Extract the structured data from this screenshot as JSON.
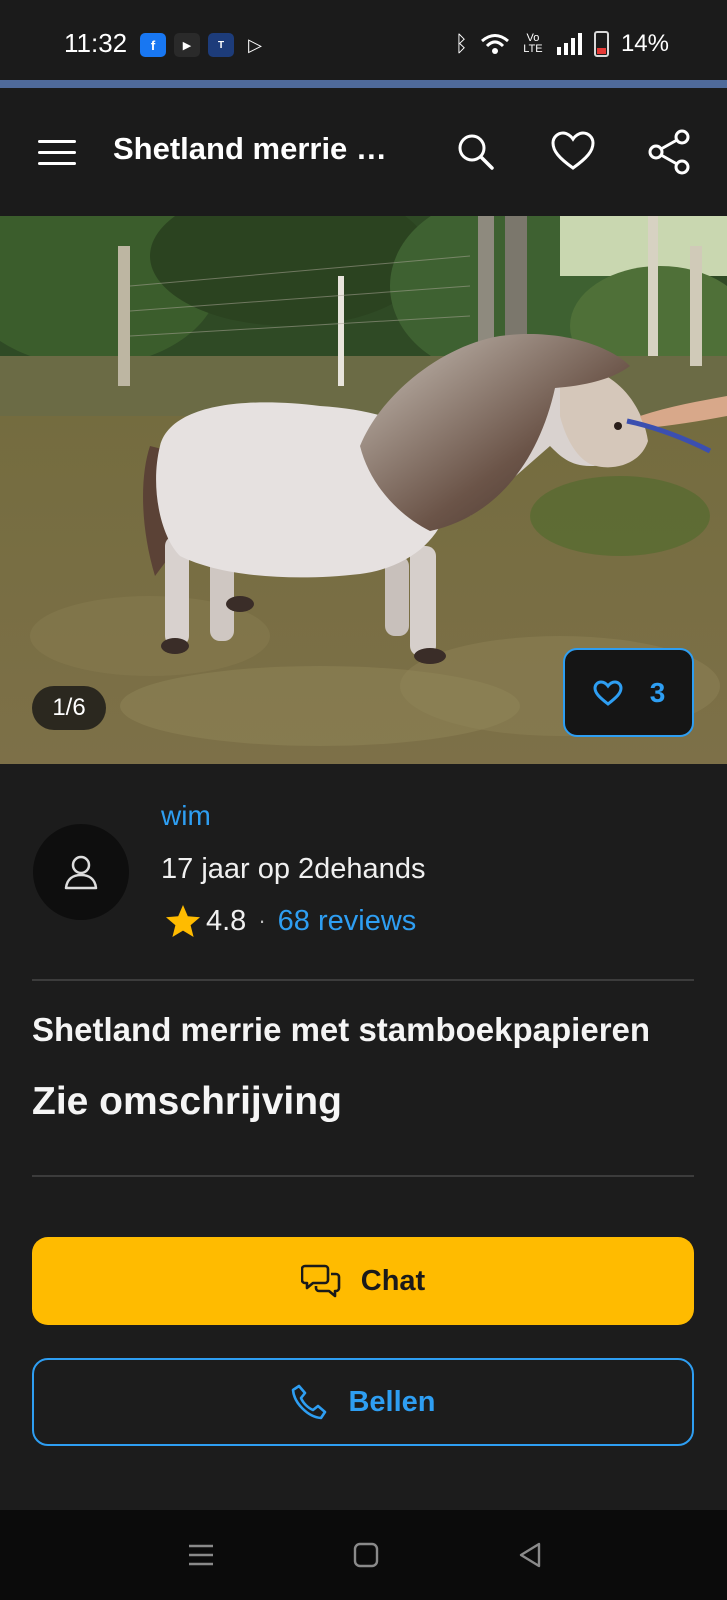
{
  "status_bar": {
    "time": "11:32",
    "app_icons": [
      {
        "name": "facebook-icon",
        "glyph": "f",
        "bg": "#1877f2",
        "fg": "#ffffff"
      },
      {
        "name": "youtube-icon",
        "glyph": "▶",
        "bg": "#2a2a2a",
        "fg": "#ffffff"
      },
      {
        "name": "de-tijd-icon",
        "glyph": "T",
        "bg": "#1d3c7a",
        "fg": "#ffffff"
      },
      {
        "name": "play-store-icon",
        "glyph": "▷",
        "bg": "transparent",
        "fg": "#ffffff"
      }
    ],
    "network": "Vo LTE",
    "battery": "14%"
  },
  "app_bar": {
    "title": "Shetland merrie met stamboekpapieren",
    "icons": [
      "menu-icon",
      "search-icon",
      "heart-icon",
      "share-icon"
    ]
  },
  "gallery": {
    "counter": "1/6",
    "favorites_count": "3"
  },
  "seller": {
    "name": "wim",
    "member_since": "17 jaar op 2dehands",
    "rating": "4.8",
    "separator": "·",
    "reviews": "68 reviews"
  },
  "listing": {
    "title": "Shetland merrie met stamboekpapieren",
    "price": "Zie omschrijving"
  },
  "actions": {
    "chat_label": "Chat",
    "call_label": "Bellen"
  },
  "colors": {
    "accent_blue": "#2e9ef2",
    "chat_yellow": "#ffbb00",
    "background": "#1c1c1c",
    "header_line": "#4f6a9a"
  }
}
